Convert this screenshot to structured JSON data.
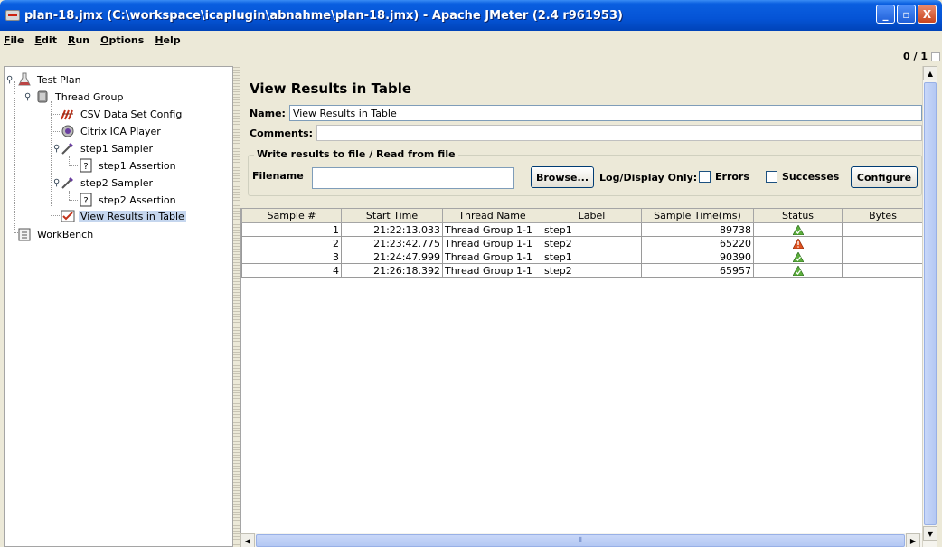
{
  "window": {
    "title": "plan-18.jmx (C:\\workspace\\icaplugin\\abnahme\\plan-18.jmx) - Apache JMeter (2.4 r961953)",
    "controls": [
      "_",
      "▫",
      "X"
    ]
  },
  "menu": {
    "items": [
      {
        "label": "File",
        "mnemonic": "F",
        "rest": "ile"
      },
      {
        "label": "Edit",
        "mnemonic": "E",
        "rest": "dit"
      },
      {
        "label": "Run",
        "mnemonic": "R",
        "rest": "un"
      },
      {
        "label": "Options",
        "mnemonic": "O",
        "rest": "ptions"
      },
      {
        "label": "Help",
        "mnemonic": "H",
        "rest": "elp"
      }
    ]
  },
  "toolbar": {
    "counter": "0 / 1"
  },
  "tree": {
    "nodes": [
      {
        "label": "Test Plan",
        "icon": "flask-icon"
      },
      {
        "label": "Thread Group",
        "icon": "spool-icon"
      },
      {
        "label": "CSV Data Set Config",
        "icon": "csv-config-icon"
      },
      {
        "label": "Citrix ICA Player",
        "icon": "citrix-icon"
      },
      {
        "label": "step1 Sampler",
        "icon": "pipette-icon"
      },
      {
        "label": "step1 Assertion",
        "icon": "question-doc-icon"
      },
      {
        "label": "step2 Sampler",
        "icon": "pipette-icon"
      },
      {
        "label": "step2 Assertion",
        "icon": "question-doc-icon"
      },
      {
        "label": "View Results in Table",
        "icon": "results-table-icon"
      },
      {
        "label": "WorkBench",
        "icon": "clipboard-icon"
      }
    ],
    "selected": "View Results in Table"
  },
  "panel": {
    "title": "View Results in Table",
    "name_label": "Name:",
    "name_value": "View Results in Table",
    "comments_label": "Comments:",
    "group_legend": "Write results to file / Read from file",
    "filename_label": "Filename",
    "filename_value": "",
    "browse_label": "Browse...",
    "log_display_label": "Log/Display Only:",
    "errors_label": "Errors",
    "successes_label": "Successes",
    "configure_label": "Configure"
  },
  "table": {
    "columns": [
      "Sample #",
      "Start Time",
      "Thread Name",
      "Label",
      "Sample Time(ms)",
      "Status",
      "Bytes"
    ],
    "rows": [
      {
        "sample": "1",
        "start": "21:22:13.033",
        "thread": "Thread Group 1-1",
        "label": "step1",
        "time": "89738",
        "status": "success",
        "bytes": ""
      },
      {
        "sample": "2",
        "start": "21:23:42.775",
        "thread": "Thread Group 1-1",
        "label": "step2",
        "time": "65220",
        "status": "warning",
        "bytes": ""
      },
      {
        "sample": "3",
        "start": "21:24:47.999",
        "thread": "Thread Group 1-1",
        "label": "step1",
        "time": "90390",
        "status": "success",
        "bytes": ""
      },
      {
        "sample": "4",
        "start": "21:26:18.392",
        "thread": "Thread Group 1-1",
        "label": "step2",
        "time": "65957",
        "status": "success",
        "bytes": ""
      }
    ]
  },
  "colors": {
    "success": "#5cae3c",
    "warning": "#e0531f",
    "selection": "#c5d6ee"
  }
}
